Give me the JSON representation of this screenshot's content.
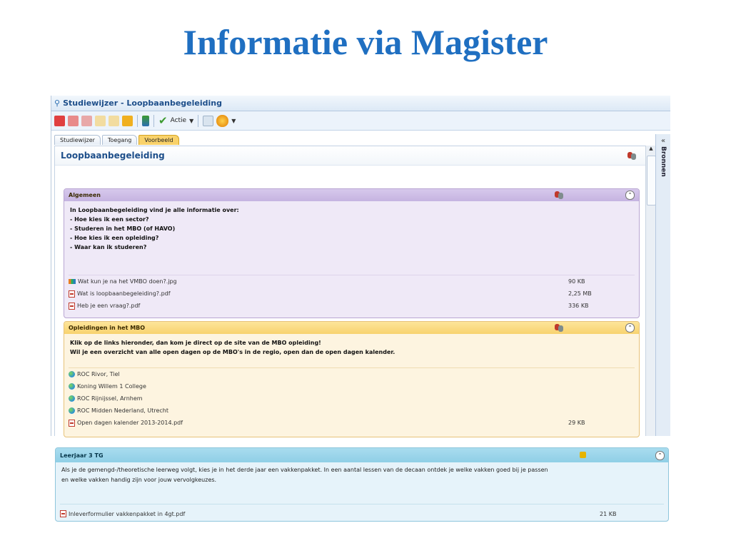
{
  "slide": {
    "title": "Informatie via Magister"
  },
  "window": {
    "title": "Studiewijzer - Loopbaanbegeleiding"
  },
  "toolbar": {
    "action_label": "Actie"
  },
  "tabs": [
    {
      "label": "Studiewijzer"
    },
    {
      "label": "Toegang"
    },
    {
      "label": "Voorbeeld",
      "active": true
    }
  ],
  "sidebar": {
    "label": "Bronnen"
  },
  "content": {
    "title": "Loopbaanbegeleiding"
  },
  "sections": [
    {
      "title": "Algemeen",
      "color": "#c5b3e1",
      "body": [
        "In Loopbaanbegeleiding vind je alle informatie over:",
        "- Hoe kies ik een sector?",
        "- Studeren in het MBO (of HAVO)",
        "- Hoe kies ik een opleiding?",
        "- Waar kan ik studeren?"
      ],
      "files": [
        {
          "name": "Wat kun je na het VMBO doen?.jpg",
          "size": "90 KB",
          "icon": "image-file-icon"
        },
        {
          "name": "Wat is loopbaanbegeleiding?.pdf",
          "size": "2,25 MB",
          "icon": "pdf-icon"
        },
        {
          "name": "Heb je een vraag?.pdf",
          "size": "336 KB",
          "icon": "pdf-icon"
        }
      ]
    },
    {
      "title": "Opleidingen in het MBO",
      "color": "#f8d26e",
      "body": [
        "Klik op de links hieronder, dan kom je direct op de site van de MBO opleiding!",
        "Wil je een overzicht van alle open dagen op de MBO's in de regio, open dan de open dagen kalender."
      ],
      "files": [
        {
          "name": "ROC Rivor, Tiel",
          "size": "",
          "icon": "web-link-icon"
        },
        {
          "name": "Koning Willem 1 College",
          "size": "",
          "icon": "web-link-icon"
        },
        {
          "name": "ROC Rijnijssel, Arnhem",
          "size": "",
          "icon": "web-link-icon"
        },
        {
          "name": "ROC Midden Nederland, Utrecht",
          "size": "",
          "icon": "web-link-icon"
        },
        {
          "name": "Open dagen kalender 2013-2014.pdf",
          "size": "29 KB",
          "icon": "pdf-icon"
        }
      ]
    },
    {
      "title": "Leerjaar 3 TG",
      "color": "#8fcfe6",
      "body": [
        "Als je de gemengd-/theoretische leerweg volgt, kies je in het derde jaar een vakkenpakket. In een aantal lessen van de decaan ontdek je welke vakken goed bij je passen",
        "en welke vakken handig zijn voor jouw vervolgkeuzes."
      ],
      "files": [
        {
          "name": "Inleverformulier vakkenpakket in 4gt.pdf",
          "size": "21 KB",
          "icon": "pdf-icon"
        }
      ]
    }
  ]
}
